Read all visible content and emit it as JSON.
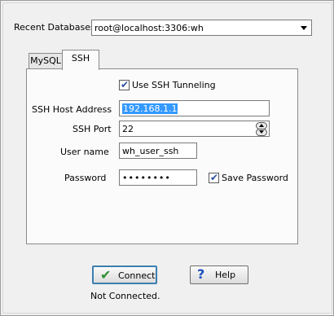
{
  "recent_databases": {
    "label": "Recent Databases",
    "selected": "root@localhost:3306:wh"
  },
  "tabs": [
    {
      "label": "MySQL",
      "active": false
    },
    {
      "label": "SSH",
      "active": true
    }
  ],
  "ssh": {
    "use_tunneling_label": "Use SSH Tunneling",
    "use_tunneling_checked": true,
    "host_label": "SSH Host Address",
    "host_value": "192.168.1.1",
    "port_label": "SSH Port",
    "port_value": "22",
    "user_label": "User name",
    "user_value": "wh_user_ssh",
    "password_label": "Password",
    "password_value": "••••••••",
    "save_password_label": "Save Password",
    "save_password_checked": true
  },
  "buttons": {
    "connect_label": "Connect",
    "help_label": "Help"
  },
  "status": "Not Connected.",
  "icons": {
    "connect": "check-icon",
    "help": "question-icon",
    "dropdown": "chevron-down-icon"
  }
}
